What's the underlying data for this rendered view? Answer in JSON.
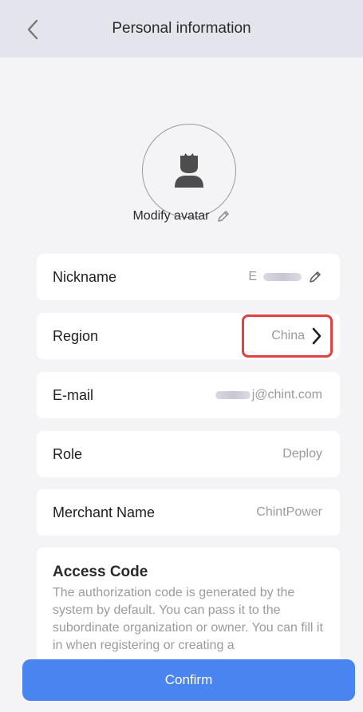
{
  "header": {
    "title": "Personal information"
  },
  "avatar": {
    "modify_label": "Modify avatar"
  },
  "fields": {
    "nickname": {
      "label": "Nickname",
      "value": "E"
    },
    "region": {
      "label": "Region",
      "value": "China"
    },
    "email": {
      "label": "E-mail",
      "value": "j@chint.com"
    },
    "role": {
      "label": "Role",
      "value": "Deploy"
    },
    "merchant": {
      "label": "Merchant Name",
      "value": "ChintPower"
    }
  },
  "access_code": {
    "title": "Access Code",
    "description": "The authorization code is generated by the system by default. You can pass it to the subordinate organization or owner. You can fill it in when registering or creating a"
  },
  "confirm_label": "Confirm",
  "colors": {
    "accent": "#4a84f0",
    "highlight": "#e04141",
    "header_bg": "#e4e4ec"
  }
}
